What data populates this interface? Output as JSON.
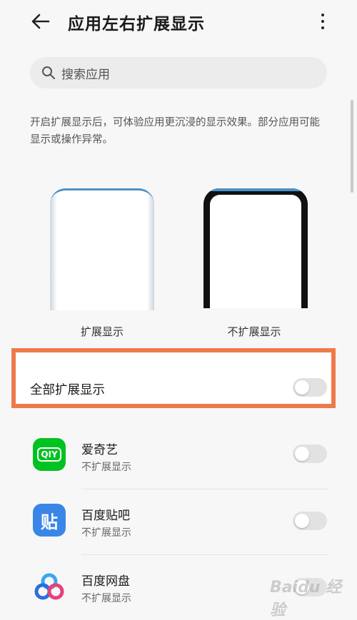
{
  "header": {
    "title": "应用左右扩展显示",
    "back_icon": "arrow-left-icon",
    "more_icon": "more-vertical-icon"
  },
  "search": {
    "placeholder": "搜索应用",
    "icon": "search-icon"
  },
  "description": "开启扩展显示后，可体验应用更沉浸的显示效果。部分应用可能显示或操作异常。",
  "preview": {
    "extended_label": "扩展显示",
    "not_extended_label": "不扩展显示"
  },
  "all_toggle": {
    "label": "全部扩展显示",
    "enabled": false
  },
  "apps": [
    {
      "name": "爱奇艺",
      "status": "不扩展显示",
      "enabled": false,
      "icon": "iqiyi-logo-icon",
      "icon_text": "QIY",
      "icon_color": "#00c220"
    },
    {
      "name": "百度贴吧",
      "status": "不扩展显示",
      "enabled": false,
      "icon": "tieba-logo-icon",
      "icon_text": "贴",
      "icon_color": "#3a86e8"
    },
    {
      "name": "百度网盘",
      "status": "不扩展显示",
      "enabled": false,
      "icon": "baidu-netdisk-logo-icon"
    }
  ],
  "watermark": "Baidu 经验",
  "colors": {
    "highlight": "#ee7a4a",
    "accent_blue": "#4a90c8"
  }
}
